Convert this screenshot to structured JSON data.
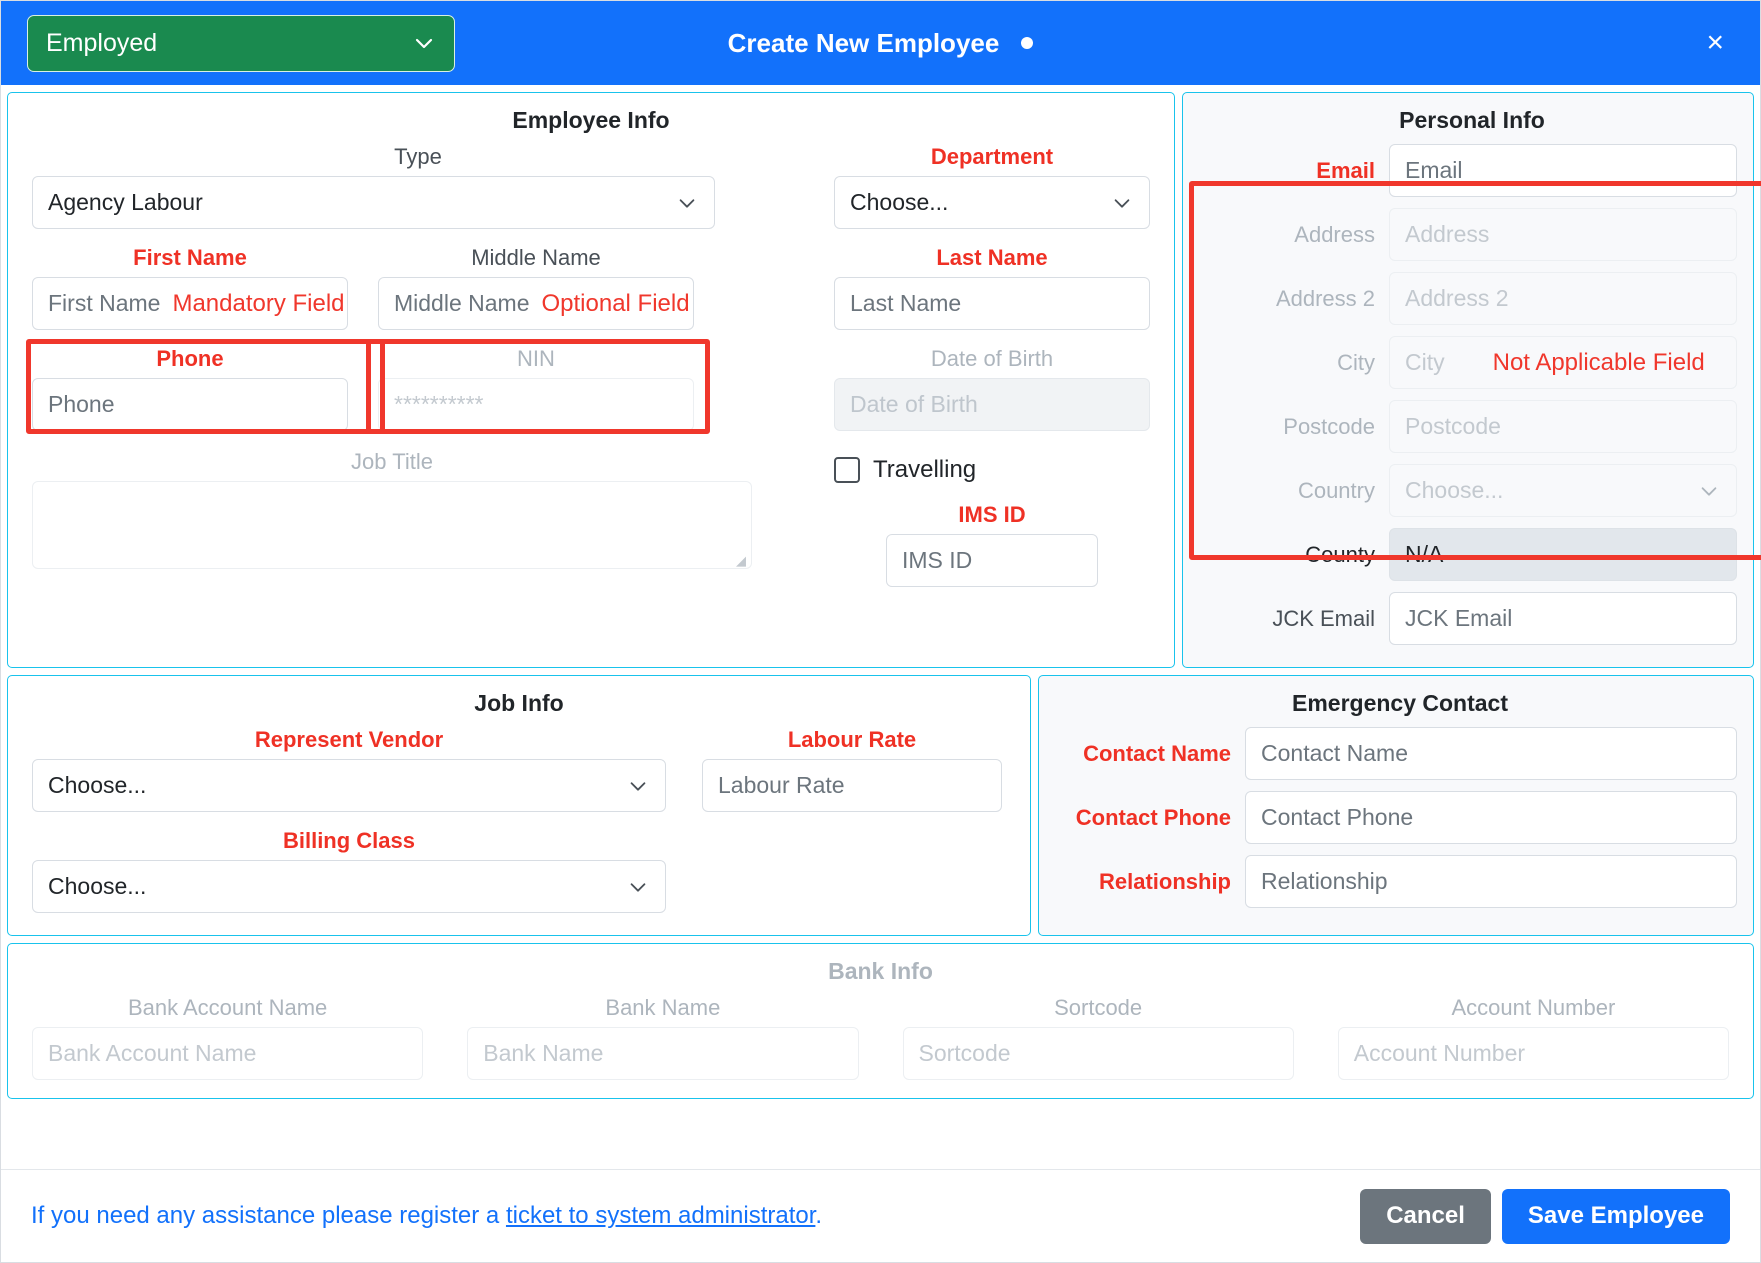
{
  "header": {
    "status_value": "Employed",
    "status_caret_icon": "chevron-down-icon",
    "title": "Create New Employee",
    "unsaved_dot": "",
    "close_label": "×"
  },
  "employee_info": {
    "title": "Employee Info",
    "type": {
      "label": "Type",
      "value": "Agency Labour"
    },
    "department": {
      "label": "Department",
      "value": "Choose...",
      "required": true
    },
    "first_name": {
      "label": "First Name",
      "placeholder": "First Name",
      "required": true,
      "annotation": "Mandatory Field"
    },
    "middle_name": {
      "label": "Middle Name",
      "placeholder": "Middle Name",
      "annotation": "Optional Field"
    },
    "last_name": {
      "label": "Last Name",
      "placeholder": "Last Name",
      "required": true
    },
    "phone": {
      "label": "Phone",
      "placeholder": "Phone",
      "required": true
    },
    "nin": {
      "label": "NIN",
      "placeholder": "**********",
      "disabled": true
    },
    "date_of_birth": {
      "label": "Date of Birth",
      "placeholder": "Date of Birth",
      "disabled": true
    },
    "job_title": {
      "label": "Job Title",
      "placeholder": "",
      "disabled": true
    },
    "travelling": {
      "label": "Travelling",
      "checked": false
    },
    "ims_id": {
      "label": "IMS ID",
      "placeholder": "IMS ID",
      "required": true
    }
  },
  "personal_info": {
    "title": "Personal Info",
    "annotation": "Not Applicable Field",
    "email": {
      "label": "Email",
      "placeholder": "Email",
      "required": true
    },
    "address": {
      "label": "Address",
      "placeholder": "Address",
      "disabled": true
    },
    "address2": {
      "label": "Address 2",
      "placeholder": "Address 2",
      "disabled": true
    },
    "city": {
      "label": "City",
      "placeholder": "City",
      "disabled": true
    },
    "postcode": {
      "label": "Postcode",
      "placeholder": "Postcode",
      "disabled": true
    },
    "country": {
      "label": "Country",
      "value": "Choose...",
      "disabled": true
    },
    "county": {
      "label": "County",
      "value": "N/A",
      "filled": true
    },
    "jck_email": {
      "label": "JCK Email",
      "placeholder": "JCK Email"
    }
  },
  "job_info": {
    "title": "Job Info",
    "represent_vendor": {
      "label": "Represent Vendor",
      "value": "Choose...",
      "required": true
    },
    "labour_rate": {
      "label": "Labour Rate",
      "placeholder": "Labour Rate",
      "required": true
    },
    "billing_class": {
      "label": "Billing Class",
      "value": "Choose...",
      "required": true
    }
  },
  "emergency_contact": {
    "title": "Emergency Contact",
    "contact_name": {
      "label": "Contact Name",
      "placeholder": "Contact Name",
      "required": true
    },
    "contact_phone": {
      "label": "Contact Phone",
      "placeholder": "Contact Phone",
      "required": true
    },
    "relationship": {
      "label": "Relationship",
      "placeholder": "Relationship",
      "required": true
    }
  },
  "bank_info": {
    "title": "Bank Info",
    "account_name": {
      "label": "Bank Account Name",
      "placeholder": "Bank Account Name",
      "disabled": true
    },
    "bank_name": {
      "label": "Bank Name",
      "placeholder": "Bank Name",
      "disabled": true
    },
    "sortcode": {
      "label": "Sortcode",
      "placeholder": "Sortcode",
      "disabled": true
    },
    "account_number": {
      "label": "Account Number",
      "placeholder": "Account Number",
      "disabled": true
    }
  },
  "footer": {
    "assist_prefix": "If you need any assistance please register a ",
    "assist_link": "ticket to system administrator",
    "assist_suffix": ".",
    "cancel_label": "Cancel",
    "save_label": "Save Employee"
  },
  "colors": {
    "header_blue": "#1271fb",
    "status_green": "#1a8a4f",
    "required_red": "#ef3125",
    "annotation_red": "#f0372c",
    "panel_border_cyan": "#19c3ec"
  }
}
